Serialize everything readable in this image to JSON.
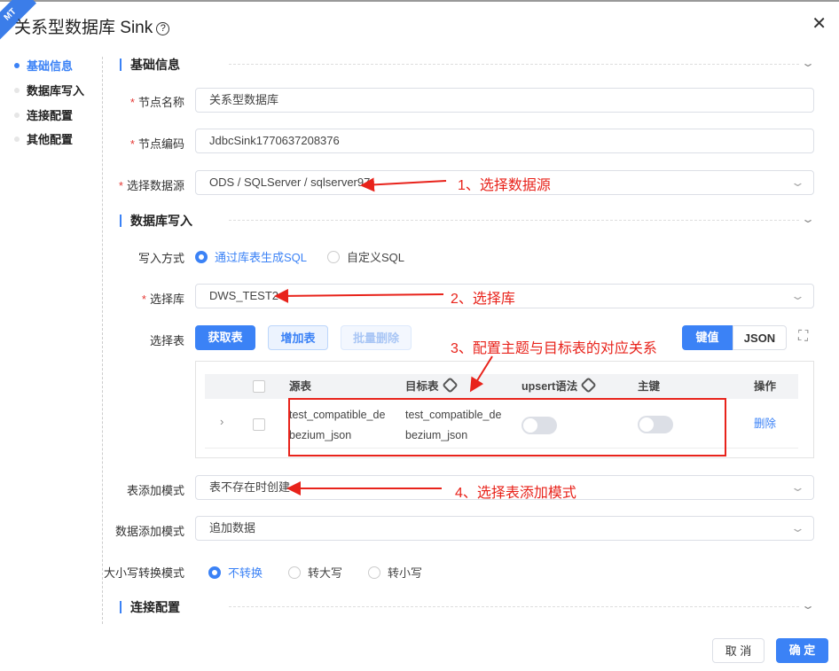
{
  "badge": "MT",
  "title": "关系型数据库 Sink",
  "help_icon": "?",
  "nav": [
    "基础信息",
    "数据库写入",
    "连接配置",
    "其他配置"
  ],
  "sections": {
    "basic": "基础信息",
    "db_write": "数据库写入",
    "conn": "连接配置"
  },
  "fields": {
    "node_name": {
      "label": "节点名称",
      "value": "关系型数据库"
    },
    "node_code": {
      "label": "节点编码",
      "value": "JdbcSink1770637208376"
    },
    "datasource": {
      "label": "选择数据源",
      "value": "ODS / SQLServer / sqlserver97"
    },
    "write_mode": {
      "label": "写入方式",
      "options": [
        "通过库表生成SQL",
        "自定义SQL"
      ],
      "selected": "通过库表生成SQL"
    },
    "database": {
      "label": "选择库",
      "value": "DWS_TEST2"
    },
    "table": {
      "label": "选择表",
      "buttons": [
        "获取表",
        "增加表",
        "批量删除"
      ],
      "view_toggle": [
        "键值",
        "JSON"
      ],
      "view_selected": "键值"
    },
    "table_add_mode": {
      "label": "表添加模式",
      "value": "表不存在时创建"
    },
    "data_add_mode": {
      "label": "数据添加模式",
      "value": "追加数据"
    },
    "case_mode": {
      "label": "大小写转换模式",
      "options": [
        "不转换",
        "转大写",
        "转小写"
      ],
      "selected": "不转换"
    }
  },
  "grid": {
    "columns": [
      "源表",
      "目标表",
      "upsert语法",
      "主键",
      "操作"
    ],
    "rows": [
      {
        "source_l1": "test_compatible_de",
        "source_l2": "bezium_json",
        "target_l1": "test_compatible_de",
        "target_l2": "bezium_json",
        "upsert": false,
        "primary_key": false,
        "action": "删除"
      }
    ]
  },
  "annotations": [
    "1、选择数据源",
    "2、选择库",
    "3、配置主题与目标表的对应关系",
    "4、选择表添加模式"
  ],
  "footer": {
    "cancel": "取 消",
    "ok": "确 定"
  },
  "colors": {
    "primary": "#3b82f6",
    "annotation": "#e8231b"
  }
}
